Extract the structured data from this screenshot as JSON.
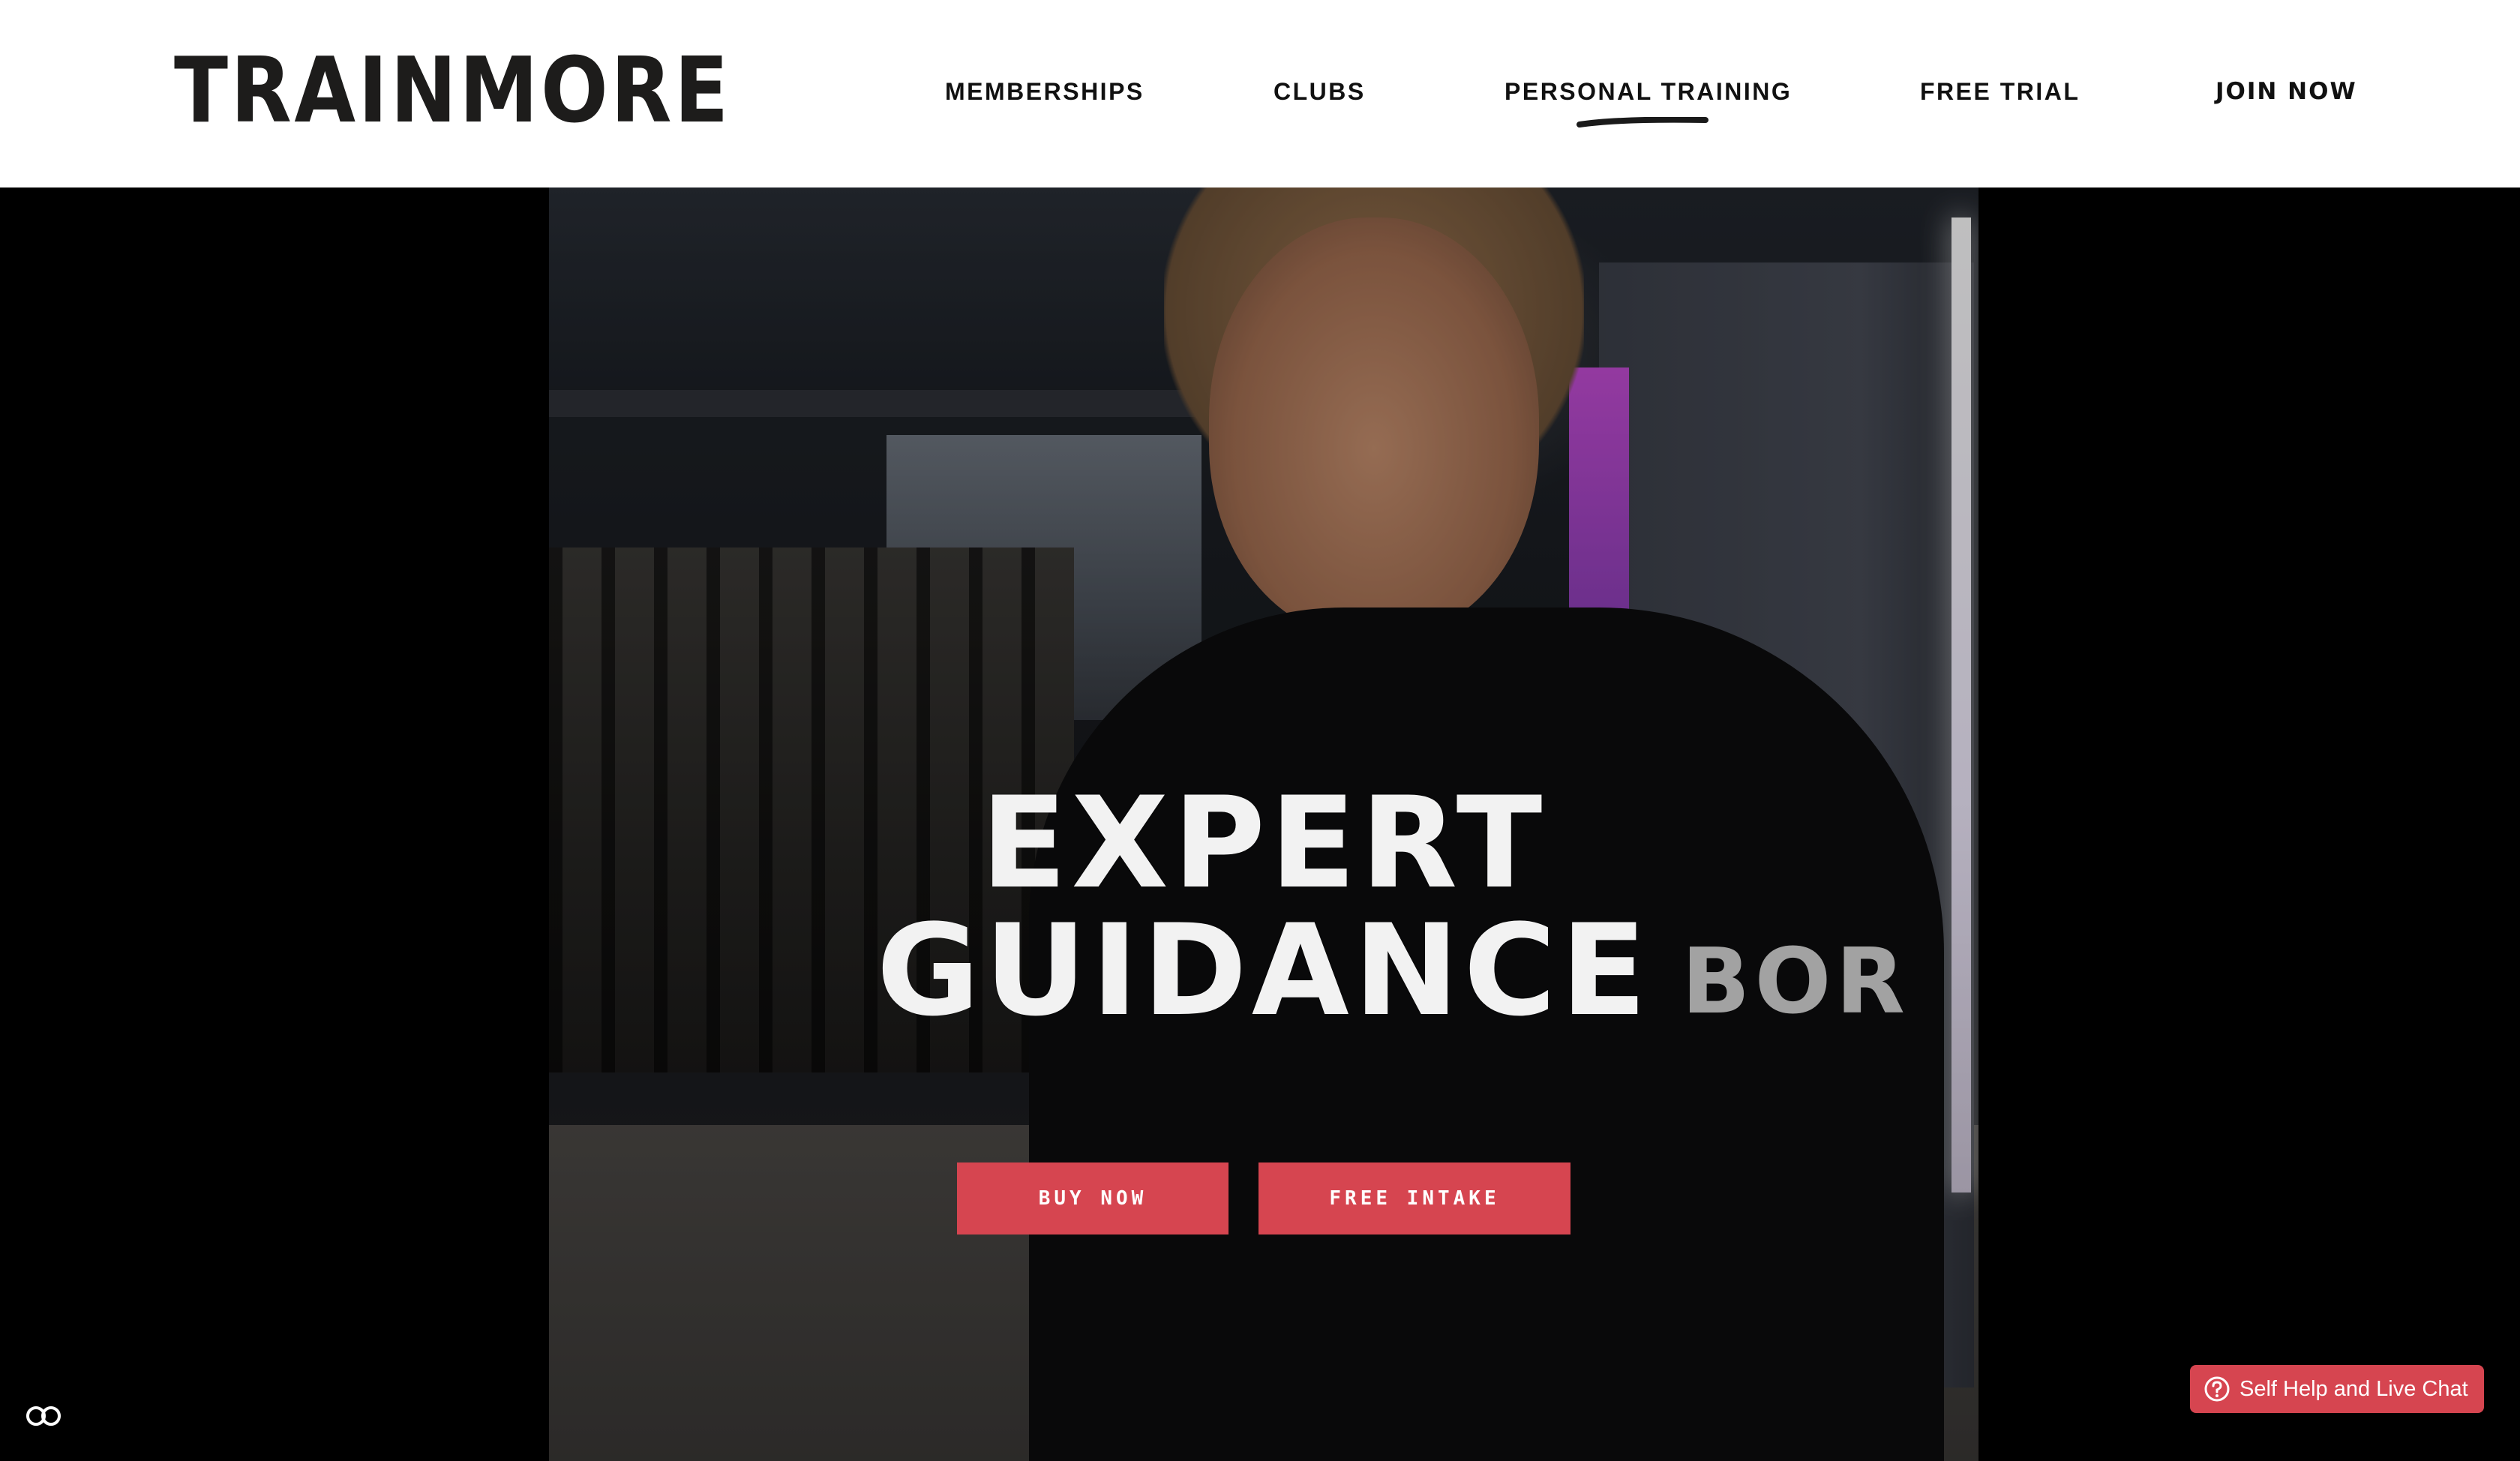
{
  "header": {
    "logo_text": "TRAINMORE",
    "nav": {
      "memberships": "MEMBERSHIPS",
      "clubs": "CLUBS",
      "personal_training": "PERSONAL TRAINING",
      "free_trial": "FREE TRIAL",
      "join_now": "JOIN NOW"
    },
    "active_nav": "personal_training"
  },
  "hero": {
    "headline_line1": "EXPERT",
    "headline_line2": "GUIDANCE",
    "shirt_text": "BOR",
    "buttons": {
      "buy_now": "BUY NOW",
      "free_intake": "FREE INTAKE"
    }
  },
  "widgets": {
    "cookie_icon": "cookie-settings-icon",
    "chat_label": "Self Help and Live Chat",
    "chat_icon": "help-circle-icon"
  },
  "colors": {
    "accent": "#d64550",
    "header_bg": "#ffffff",
    "text_dark": "#111111",
    "hero_bg": "#000000"
  }
}
